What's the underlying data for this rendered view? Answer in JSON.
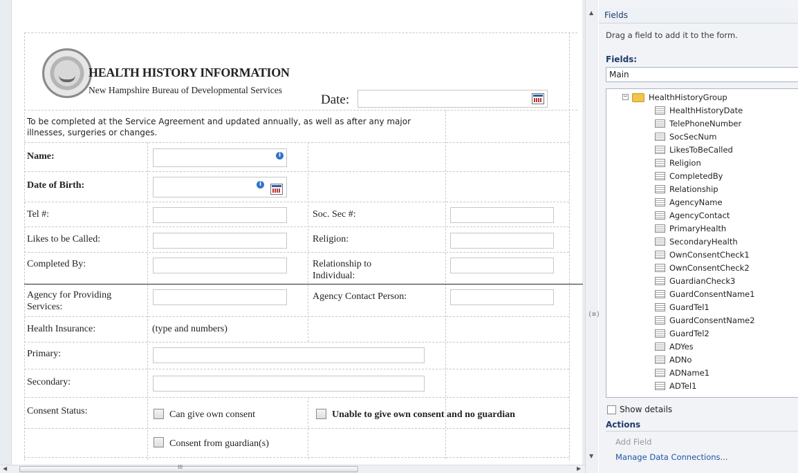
{
  "form": {
    "title": "HEALTH HISTORY INFORMATION",
    "subtitle": "New Hampshire Bureau of Developmental Services",
    "date_label": "Date:",
    "instructions": "To be completed at the Service Agreement and updated annually, as well as after any major illnesses, surgeries or changes.",
    "rows": {
      "name": "Name:",
      "dob": "Date of Birth:",
      "tel": "Tel #:",
      "ssn": "Soc. Sec #:",
      "likes": "Likes to be Called:",
      "religion": "Religion:",
      "completed_by": "Completed By:",
      "relationship": "Relationship to Individual:",
      "agency": "Agency for Providing Services:",
      "agency_contact": "Agency Contact Person:",
      "health_insurance": "Health Insurance:",
      "type_numbers": "(type and numbers)",
      "primary": "Primary:",
      "secondary": "Secondary:",
      "consent_status": "Consent Status:",
      "own_consent": "Can give own consent",
      "unable_consent": "Unable to give own consent and no guardian",
      "guardian_consent": "Consent from guardian(s)"
    },
    "info_glyph": "i"
  },
  "scroll": {
    "up_arrow": "▲",
    "down_arrow": "▼",
    "left_arrow": "◀",
    "right_arrow": "▶",
    "grip": "(≡)",
    "thumb_grip": "III"
  },
  "pane": {
    "title": "Fields",
    "hint": "Drag a field to add it to the form.",
    "fields_label": "Fields:",
    "data_source": "Main",
    "tree_toggle": "−",
    "group": "HealthHistoryGroup",
    "fields": [
      "HealthHistoryDate",
      "TelePhoneNumber",
      "SocSecNum",
      "LikesToBeCalled",
      "Religion",
      "CompletedBy",
      "Relationship",
      "AgencyName",
      "AgencyContact",
      "PrimaryHealth",
      "SecondaryHealth",
      "OwnConsentCheck1",
      "OwnConsentCheck2",
      "GuardianCheck3",
      "GuardConsentName1",
      "GuardTel1",
      "GuardConsentName2",
      "GuardTel2",
      "ADYes",
      "ADNo",
      "ADName1",
      "ADTel1"
    ],
    "show_details": "Show details",
    "actions_label": "Actions",
    "add_field": "Add Field",
    "manage_connections": "Manage Data Connections..."
  }
}
